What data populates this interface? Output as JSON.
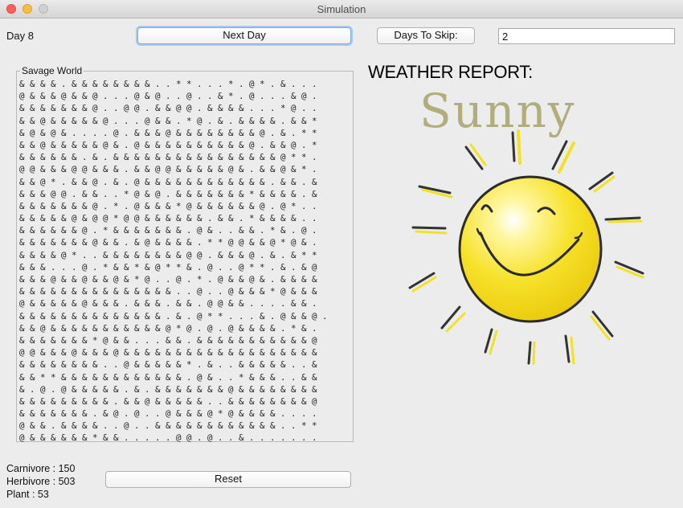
{
  "window": {
    "title": "Simulation"
  },
  "day_label": "Day 8",
  "buttons": {
    "next_day": "Next Day",
    "days_to_skip": "Days To Skip:",
    "reset": "Reset"
  },
  "skip_input": {
    "value": "2"
  },
  "world": {
    "label": "Savage World",
    "rows": [
      "& & & & . & & & & & & & & . . * * . . . * . @ * . & . . .",
      "@ & & & @ & & @ . . . @ & @ . . @ . . & * . @ . . . & @ .",
      "& & & & & & & @ . . @ @ . & & @ @ . & & & & . . . * @ . .",
      "& & @ & & & & & @ . . . @ & & . * @ . & . & & & & . & & *",
      "& @ & @ & . . . . @ . & & & @ & & & & & & & & @ . & . * *",
      "& & @ & & & & & @ & . @ & & & & & & & & & & @ . & & @ . *",
      "& & & & & & . & . & & & & & & & & & & & & & & & & @ * * .",
      "@ @ & & & @ @ & & & . & & @ @ & & & & & @ & . & & @ & * .",
      "& & @ * . & & @ . & . @ & & & & & & & & & & & & . & & . &",
      "& & & @ @ . & & . . * @ & @ . & & & & & & & * & & & & . &",
      "& & & & & & & @ . * . @ & & & * @ & & & & & & @ . @ * . .",
      "& & & & & @ & @ @ * @ @ & & & & & & . & & . * & & & & . .",
      "& & & & & & @ . * & & & & & & & . @ & . . & & . * & . @ .",
      "& & & & & & & @ & & . & @ & & & & . * * @ @ & & @ * @ & .",
      "& & & & @ * . . & & & & & & & & @ @ . & & & @ . & . & * *",
      "& & & . . . @ . * & & * & @ * * & . @ . . @ * * . & . & @",
      "& & & @ & & @ & & @ & * @ . . @ . * . @ & & @ & . & & & &",
      "& & & & & & & & & & & & & & & . . @ . . @ & & & * @ & & &",
      "@ & & & & & @ & & & . & & & . & & . @ @ & & . . . . & & .",
      "& & & & & & & & & & & & & & . & . @ * * . . . & . @ & & @ .",
      "& & @ & & & & & & & & & & & @ * @ . @ . @ & & & & . * & .",
      "& & & & & & & * @ & & . . . & & . & & & & & & & & & & & @",
      "@ @ & & & @ & & & @ & & & & & & & & & & & & & & & & & & &",
      "& & & & & & & & . . @ & & & & & * . & . . & & & & & . . &",
      "& & * * & & & & & & & & & & & & . @ & . . * & & & . . & &",
      "& . @ . @ & & & & & . & . & & & & & & & @ & & & & & & & &",
      "& & & & & & & & & . & & @ & & & & & . . & & & & & & & & @",
      "& & & & & & & . & @ . @ . . @ & & & @ * @ & & & & . . . .",
      "@ & & . & & & & . . @ . . & & & & & & & & & & & & . . * *",
      "@ & & & & & & * & & . . . . . @ @ . @ . . & . . . . . . ."
    ]
  },
  "weather": {
    "heading": "WEATHER REPORT:",
    "condition": "Sunny",
    "sun_icon": "sun-icon"
  },
  "stats": {
    "carnivore": "Carnivore : 150",
    "herbivore": "Herbivore : 503",
    "plant": "Plant : 53"
  }
}
